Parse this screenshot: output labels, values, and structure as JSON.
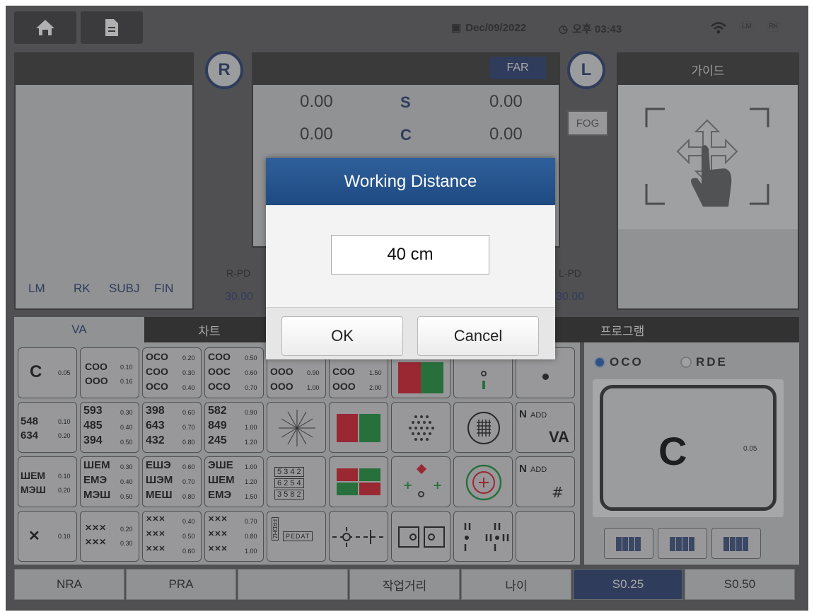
{
  "top": {
    "date": "Dec/09/2022",
    "time": "오후 03:43",
    "lm": "LM",
    "rk": "RK"
  },
  "left_panel": {
    "tabs": [
      "LM",
      "RK",
      "SUBJ",
      "FIN"
    ]
  },
  "center": {
    "r": "R",
    "l": "L",
    "far": "FAR",
    "fog": "FOG",
    "rows": [
      {
        "left": "0.00",
        "label": "S",
        "right": "0.00"
      },
      {
        "left": "0.00",
        "label": "C",
        "right": "0.00"
      }
    ],
    "rpd_label": "R-PD",
    "rpd": "30.00",
    "lpd_label": "L-PD",
    "lpd": "30.00"
  },
  "guide": {
    "title": "가이드"
  },
  "tabs": {
    "va": "VA",
    "chart": "차트",
    "program": "프로그램"
  },
  "grid": {
    "c1": [
      "C",
      "0.05"
    ],
    "c2": [
      "COO",
      "0.10",
      "OOO",
      "0.16"
    ],
    "c3": [
      "OCO",
      "0.20",
      "COO",
      "0.30",
      "OCO",
      "0.40"
    ],
    "c4": [
      "COO",
      "0.50",
      "OOC",
      "0.60",
      "OCO",
      "0.70"
    ],
    "c5": [
      "OOO",
      "0.90",
      "OOO",
      "1.00"
    ],
    "c6": [
      "COO",
      "1.50",
      "OOO",
      "2.00"
    ],
    "n1": [
      "548",
      "0.10",
      "634",
      "0.20"
    ],
    "n2": [
      "593",
      "0.30",
      "485",
      "0.40",
      "394",
      "0.50"
    ],
    "n3": [
      "398",
      "0.60",
      "643",
      "0.70",
      "432",
      "0.80"
    ],
    "n4": [
      "582",
      "0.90",
      "849",
      "1.00",
      "245",
      "1.20"
    ],
    "e1": [
      "ШЕМ",
      "0.10",
      "МЭШ",
      "0.20"
    ],
    "e2": [
      "ШЕМ",
      "0.30",
      "ЕМЭ",
      "0.40",
      "МЭШ",
      "0.50"
    ],
    "e3": [
      "ЕШЭ",
      "0.60",
      "ШЭМ",
      "0.70",
      "МЕШ",
      "0.80"
    ],
    "e4": [
      "ЭШЕ",
      "1.00",
      "ШЕМ",
      "1.20",
      "ЕМЭ",
      "1.50"
    ],
    "b1": [
      "0.10"
    ],
    "b2": [
      "0.20",
      "0.30"
    ],
    "b3": [
      "0.40",
      "0.50",
      "0.60"
    ],
    "b4": [
      "0.70",
      "0.80",
      "1.00"
    ],
    "digits": [
      "5 3 4 2",
      "6 2 5 4",
      "3 5 8 2"
    ],
    "nadd1": [
      "N",
      "ADD",
      "VA"
    ],
    "nadd2": [
      "N",
      "ADD"
    ],
    "pedat": "PEDAT",
    "frdhz": "FRDHZ"
  },
  "program": {
    "opt1": "OCO",
    "opt2": "RDE",
    "preview_letter": "C",
    "preview_value": "0.05"
  },
  "bottom": [
    "NRA",
    "PRA",
    "",
    "작업거리",
    "나이",
    "S0.25",
    "S0.50"
  ],
  "dialog": {
    "title": "Working Distance",
    "value": "40 cm",
    "ok": "OK",
    "cancel": "Cancel"
  }
}
